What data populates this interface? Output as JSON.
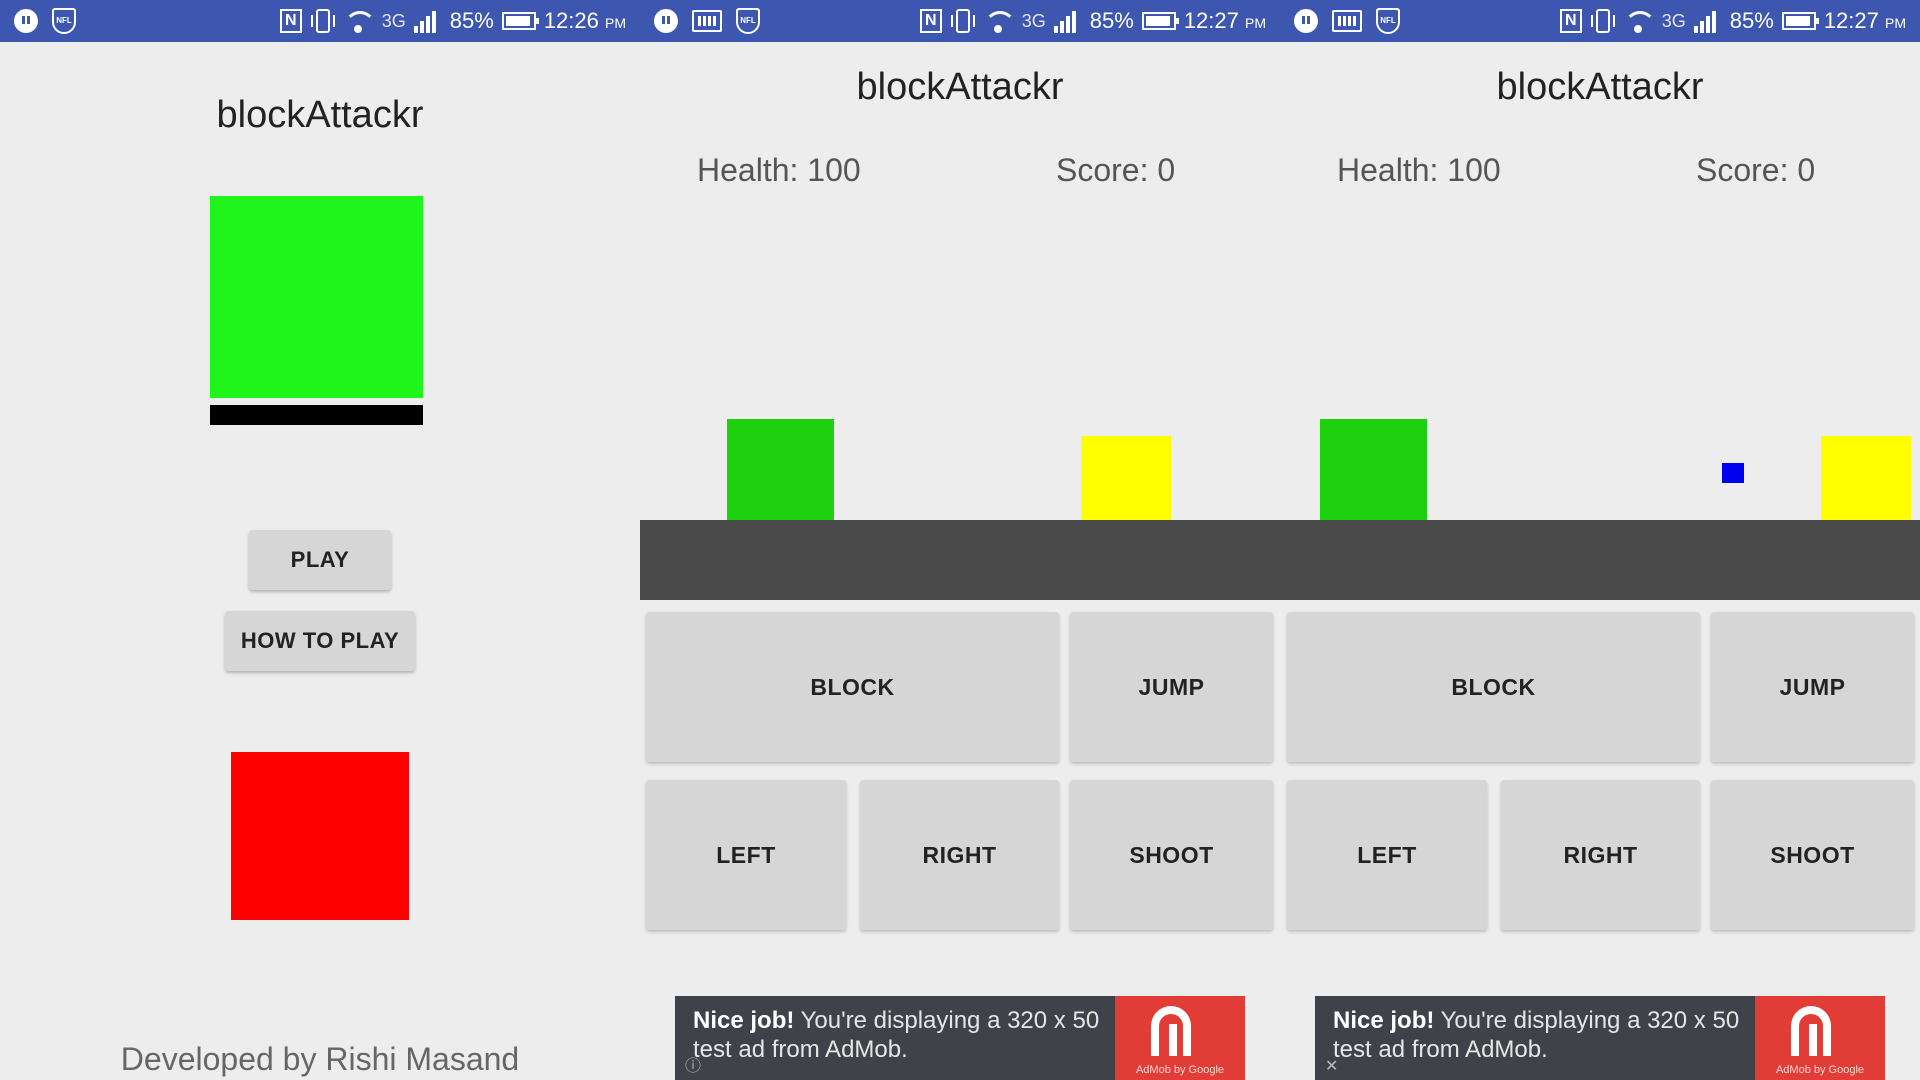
{
  "status_bars": [
    {
      "battery": "85%",
      "time": "12:26",
      "ampm": "PM",
      "network": "3G",
      "nfl_label": "NFL",
      "nfc_label": "N"
    },
    {
      "battery": "85%",
      "time": "12:27",
      "ampm": "PM",
      "network": "3G",
      "nfl_label": "NFL",
      "nfc_label": "N"
    },
    {
      "battery": "85%",
      "time": "12:27",
      "ampm": "PM",
      "network": "3G",
      "nfl_label": "NFL",
      "nfc_label": "N"
    }
  ],
  "menu": {
    "title": "blockAttackr",
    "play_label": "PLAY",
    "how_to_play_label": "HOW TO PLAY",
    "credit": "Developed by Rishi Masand",
    "colors": {
      "player": "#1ff51a",
      "shadow": "#000000",
      "enemy": "#ff0000"
    }
  },
  "games": [
    {
      "title": "blockAttackr",
      "health_label": "Health: 100",
      "score_label": "Score: 0",
      "buttons": {
        "block": "BLOCK",
        "jump": "JUMP",
        "left": "LEFT",
        "right": "RIGHT",
        "shoot": "SHOOT"
      },
      "ad": {
        "headline": "Nice job!",
        "body": " You're displaying a 320 x 50 test ad from AdMob.",
        "logo_text": "AdMob by Google",
        "corner_icon": "ⓘ"
      }
    },
    {
      "title": "blockAttackr",
      "health_label": "Health: 100",
      "score_label": "Score: 0",
      "buttons": {
        "block": "BLOCK",
        "jump": "JUMP",
        "left": "LEFT",
        "right": "RIGHT",
        "shoot": "SHOOT"
      },
      "ad": {
        "headline": "Nice job!",
        "body": " You're displaying a 320 x 50 test ad from AdMob.",
        "logo_text": "AdMob by Google",
        "corner_icon": "✕"
      }
    }
  ],
  "colors": {
    "status_bar": "#3d56b0",
    "background": "#ededed",
    "ground": "#4a4a4a",
    "player_block": "#1ed10f",
    "enemy_block": "#ffff00",
    "bullet": "#0000ee",
    "ad_background": "#3f4349",
    "ad_logo": "#e23c36"
  }
}
